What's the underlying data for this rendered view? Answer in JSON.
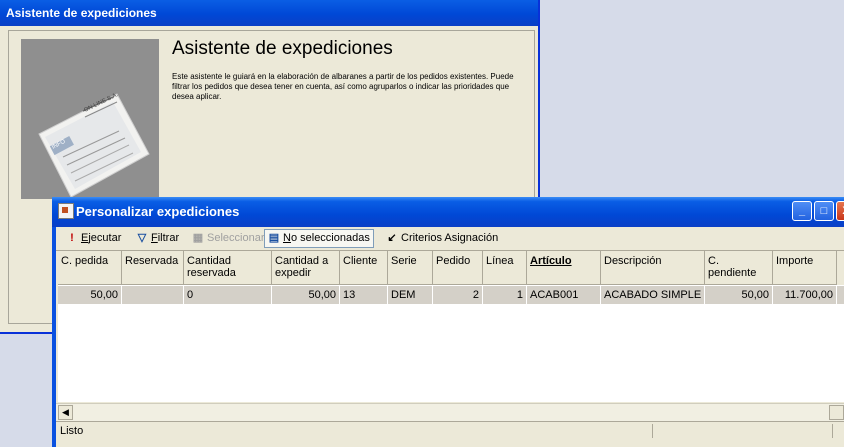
{
  "wizard": {
    "title": "Asistente de expediciones",
    "heading": "Asistente de expediciones",
    "description": "Este asistente le guiará en la elaboración de albaranes a partir de los pedidos existentes. Puede filtrar los pedidos que desea tener en cuenta, así como agruparlos o indicar las prioridades que desea aplicar.",
    "document_image": {
      "text_lines": [
        "ON LINE S.A.",
        "INFO"
      ]
    }
  },
  "window": {
    "title": "Personalizar expediciones",
    "buttons": {
      "minimize": "_",
      "maximize": "□",
      "close": "X"
    }
  },
  "toolbar": {
    "ejecutar": {
      "pre": "",
      "u": "E",
      "post": "jecutar"
    },
    "filtrar": {
      "pre": "",
      "u": "F",
      "post": "iltrar"
    },
    "seleccionar": "Seleccionar",
    "no_seleccionadas": {
      "pre": "",
      "u": "N",
      "post": "o seleccionadas"
    },
    "criterios": "Criterios Asignación"
  },
  "table": {
    "columns": [
      "C. pedida",
      "Reservada",
      "Cantidad reservada",
      "Cantidad a expedir",
      "Cliente",
      "Serie",
      "Pedido",
      "Línea",
      "Artículo",
      "Descripción",
      "C. pendiente",
      "Importe"
    ],
    "rows": [
      [
        "50,00",
        "",
        "0",
        "50,00",
        "13",
        "DEM",
        "2",
        "1",
        "ACAB001",
        "ACABADO SIMPLE",
        "50,00",
        "11.700,00"
      ]
    ]
  },
  "status": {
    "text": "Listo"
  },
  "colors": {
    "titlebar": "#0054e3",
    "window_bg": "#ece9d8",
    "row_selected": "#d4d0c8"
  }
}
